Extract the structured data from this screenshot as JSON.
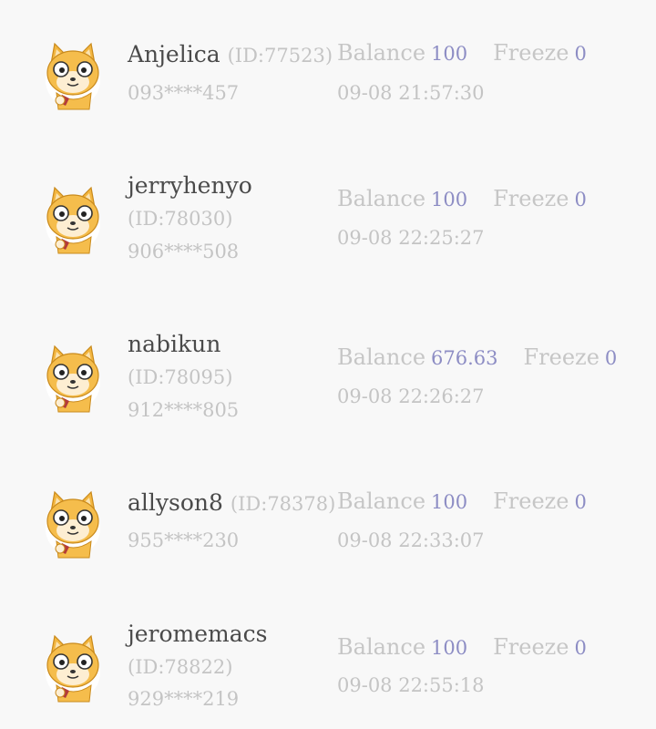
{
  "labels": {
    "balance": "Balance",
    "freeze": "Freeze"
  },
  "users": [
    {
      "name": "Anjelica",
      "id": "(ID:77523)",
      "phone": "093****457",
      "balance": "100",
      "freeze": "0",
      "time": "09-08 21:57:30",
      "avatar": "cat-avatar-icon"
    },
    {
      "name": "jerryhenyo",
      "id": "(ID:78030)",
      "phone": "906****508",
      "balance": "100",
      "freeze": "0",
      "time": "09-08 22:25:27",
      "avatar": "cat-avatar-icon"
    },
    {
      "name": "nabikun",
      "id": "(ID:78095)",
      "phone": "912****805",
      "balance": "676.63",
      "freeze": "0",
      "time": "09-08 22:26:27",
      "avatar": "cat-avatar-icon"
    },
    {
      "name": "allyson8",
      "id": "(ID:78378)",
      "phone": "955****230",
      "balance": "100",
      "freeze": "0",
      "time": "09-08 22:33:07",
      "avatar": "cat-avatar-icon"
    },
    {
      "name": "jeromemacs",
      "id": "(ID:78822)",
      "phone": "929****219",
      "balance": "100",
      "freeze": "0",
      "time": "09-08 22:55:18",
      "avatar": "cat-avatar-icon"
    }
  ]
}
